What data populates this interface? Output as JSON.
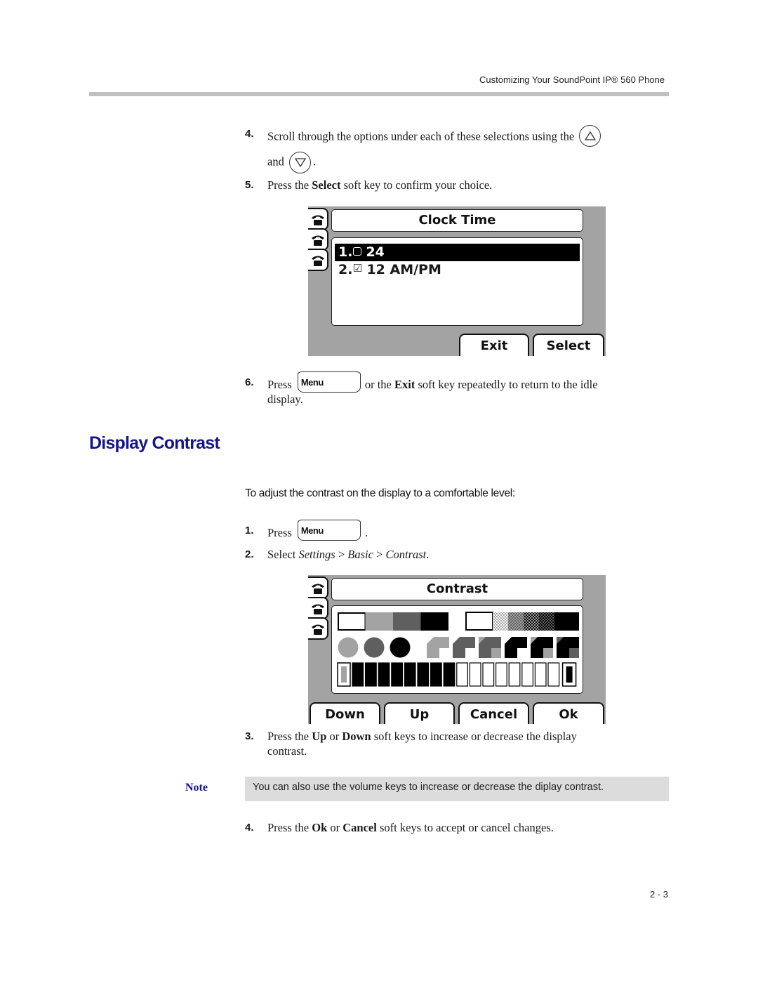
{
  "running_header": "Customizing Your SoundPoint IP® 560 Phone",
  "steps_top": [
    {
      "num": "4.",
      "line1_pre": "Scroll through the options under each of these selections using the",
      "line2_pre": "and",
      "line2_post": ".",
      "icons": [
        "up-arrow-key",
        "down-arrow-key"
      ]
    },
    {
      "num": "5.",
      "pre": "Press the ",
      "bold": "Select",
      "post": " soft key to confirm your choice."
    },
    {
      "num": "6.",
      "pre": "Press",
      "key_label": "Menu",
      "mid": "or the ",
      "bold": "Exit",
      "post": " soft key repeatedly to return to the idle",
      "line2": "display."
    }
  ],
  "clock_screen": {
    "title": "Clock Time",
    "options": [
      {
        "index": "1.",
        "label": "24",
        "checked": false,
        "selected": true
      },
      {
        "index": "2.",
        "label": "12 AM/PM",
        "checked": true,
        "selected": false
      }
    ],
    "softkeys": [
      "Exit",
      "Select"
    ],
    "check_glyph": "☑"
  },
  "section": {
    "title": "Display Contrast",
    "procedure_heading": "To adjust the contrast on the display to a comfortable level:"
  },
  "steps_bottom": [
    {
      "num": "1.",
      "pre": "Press",
      "key_label": "Menu",
      "post": "."
    },
    {
      "num": "2.",
      "pre": "Select ",
      "path": [
        "Settings",
        "Basic",
        "Contrast"
      ],
      "separator": " > ",
      "post": "."
    },
    {
      "num": "3.",
      "pre": "Press the ",
      "bold1": "Up",
      "mid": " or ",
      "bold2": "Down",
      "post": " soft keys to increase or decrease the display",
      "line2": "contrast."
    },
    {
      "num": "4.",
      "pre": "Press the ",
      "bold1": "Ok",
      "mid": " or ",
      "bold2": "Cancel",
      "post": " soft keys to accept or cancel changes."
    }
  ],
  "contrast_screen": {
    "title": "Contrast",
    "grayscale_swatches": [
      "#ffffff",
      "#a3a3a3",
      "#5f5f5f",
      "#000000"
    ],
    "circle_colors": [
      "#a3a3a3",
      "#5f5f5f",
      "#000000"
    ],
    "contrast_level": {
      "filled": 8,
      "total": 16
    },
    "softkeys": [
      "Down",
      "Up",
      "Cancel",
      "Ok"
    ]
  },
  "note": {
    "label": "Note",
    "text": "You can also use the volume keys to increase or decrease the diplay contrast."
  },
  "page_number": "2 - 3",
  "colors": {
    "heading_blue": "#15158c",
    "rule_gray": "#c0c0c0",
    "note_bg": "#dcdcdc",
    "lcd_gray": "#a3a3a3"
  }
}
